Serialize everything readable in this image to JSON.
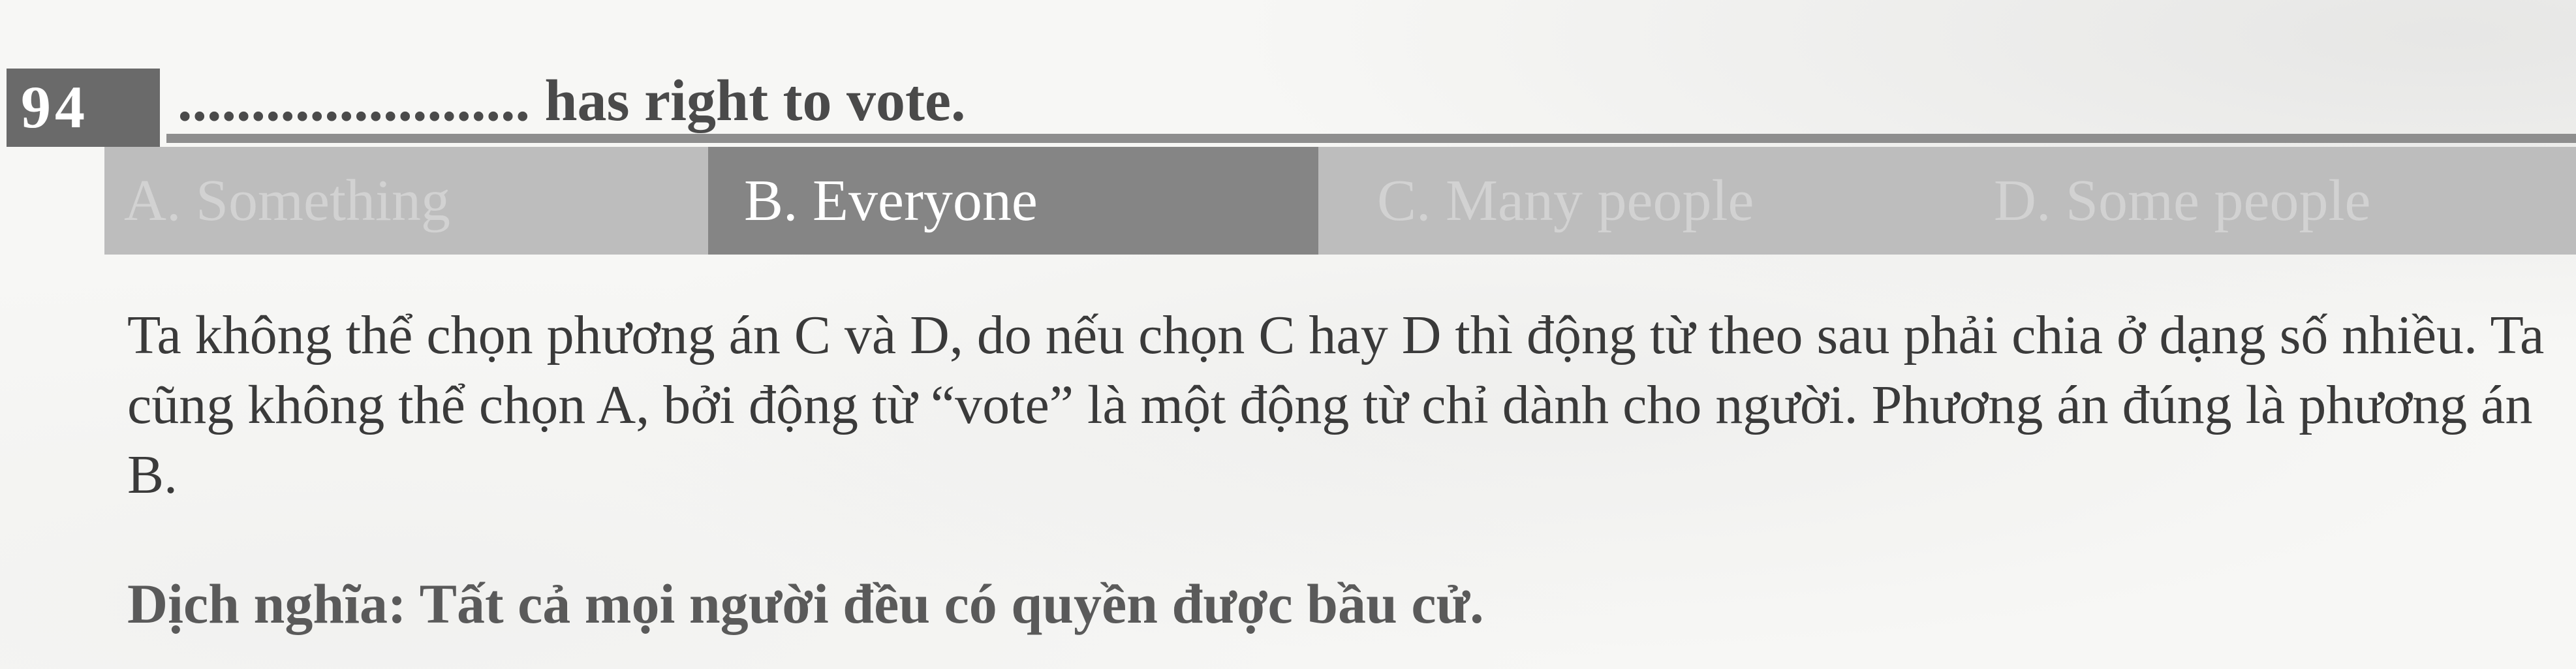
{
  "question": {
    "number": "94",
    "stem": "........................ has right to vote."
  },
  "options": [
    {
      "label": "A. Something"
    },
    {
      "label": "B. Everyone"
    },
    {
      "label": "C. Many people"
    },
    {
      "label": "D. Some people"
    }
  ],
  "highlighted_option": "B",
  "explanation": "Ta không thể chọn phương án C và D, do nếu chọn C hay D thì động từ theo sau phải chia ở dạng số nhiều. Ta cũng không thể chọn A, bởi động từ “vote” là một động từ chỉ dành cho người. Phương án đúng là phương án B.",
  "translation": "Dịch nghĩa: Tất cả mọi người đều có quyền được bầu cử."
}
